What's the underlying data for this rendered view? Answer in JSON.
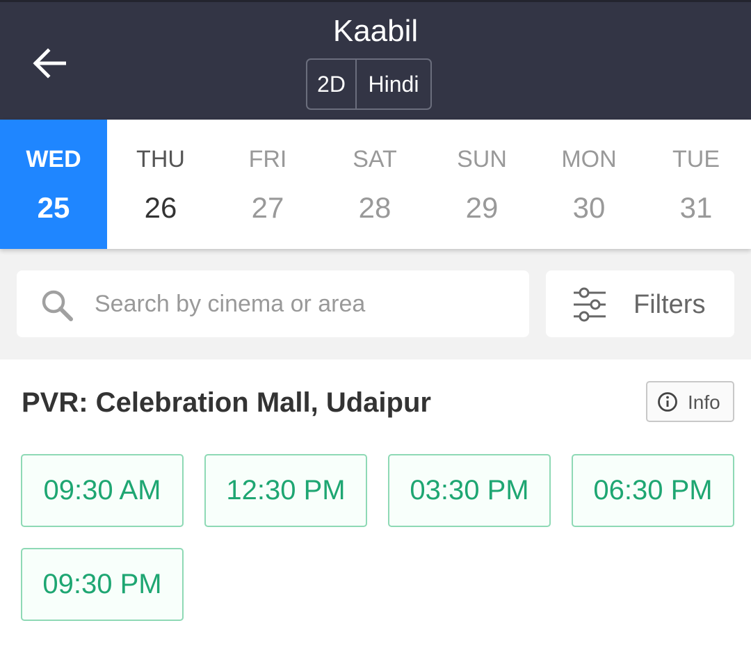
{
  "header": {
    "back_icon": "arrow-left-icon",
    "title": "Kaabil",
    "format": "2D",
    "language": "Hindi"
  },
  "dates": [
    {
      "day": "WED",
      "num": "25",
      "state": "selected"
    },
    {
      "day": "THU",
      "num": "26",
      "state": "available"
    },
    {
      "day": "FRI",
      "num": "27",
      "state": "disabled"
    },
    {
      "day": "SAT",
      "num": "28",
      "state": "disabled"
    },
    {
      "day": "SUN",
      "num": "29",
      "state": "disabled"
    },
    {
      "day": "MON",
      "num": "30",
      "state": "disabled"
    },
    {
      "day": "TUE",
      "num": "31",
      "state": "disabled"
    }
  ],
  "search": {
    "placeholder": "Search by cinema or area",
    "icon": "search-icon"
  },
  "filters": {
    "label": "Filters",
    "icon": "sliders-icon"
  },
  "cinema": {
    "name": "PVR: Celebration Mall, Udaipur",
    "info_label": "Info",
    "info_icon": "info-circle-icon",
    "showtimes": [
      "09:30 AM",
      "12:30 PM",
      "03:30 PM",
      "06:30 PM",
      "09:30 PM"
    ]
  },
  "colors": {
    "header_bg": "#333545",
    "selected_date": "#1f86ff",
    "showtime_green": "#1ea672",
    "showtime_border": "#8ed9b5"
  }
}
